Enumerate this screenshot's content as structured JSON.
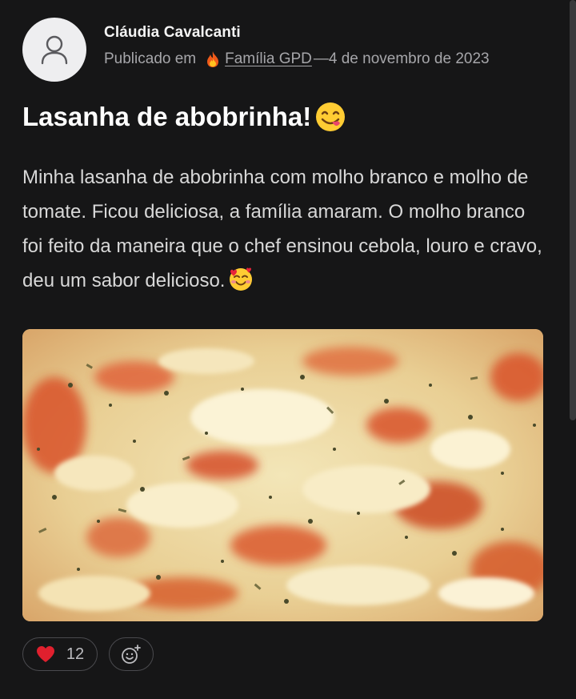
{
  "post": {
    "author": "Cláudia Cavalcanti",
    "published_prefix": "Publicado em",
    "group_name": "Família GPD",
    "date_separator": "—",
    "date": "4 de novembro de 2023",
    "title": "Lasanha de abobrinha!",
    "title_emoji": "face-savoring-food-emoji",
    "body": "Minha lasanha de abobrinha com molho branco e molho de tomate. Ficou deliciosa, a família amaram. O molho branco foi feito da maneira que o chef ensinou cebola, louro e cravo, deu um sabor delicioso.",
    "body_emoji": "smiling-face-with-hearts-emoji",
    "image_description_icon": "lasagna-photo"
  },
  "reactions": {
    "like_icon": "heart-icon",
    "like_count": "12",
    "add_reaction_icon": "add-emoji-icon"
  },
  "colors": {
    "background": "#161617",
    "heart": "#e0202e"
  }
}
